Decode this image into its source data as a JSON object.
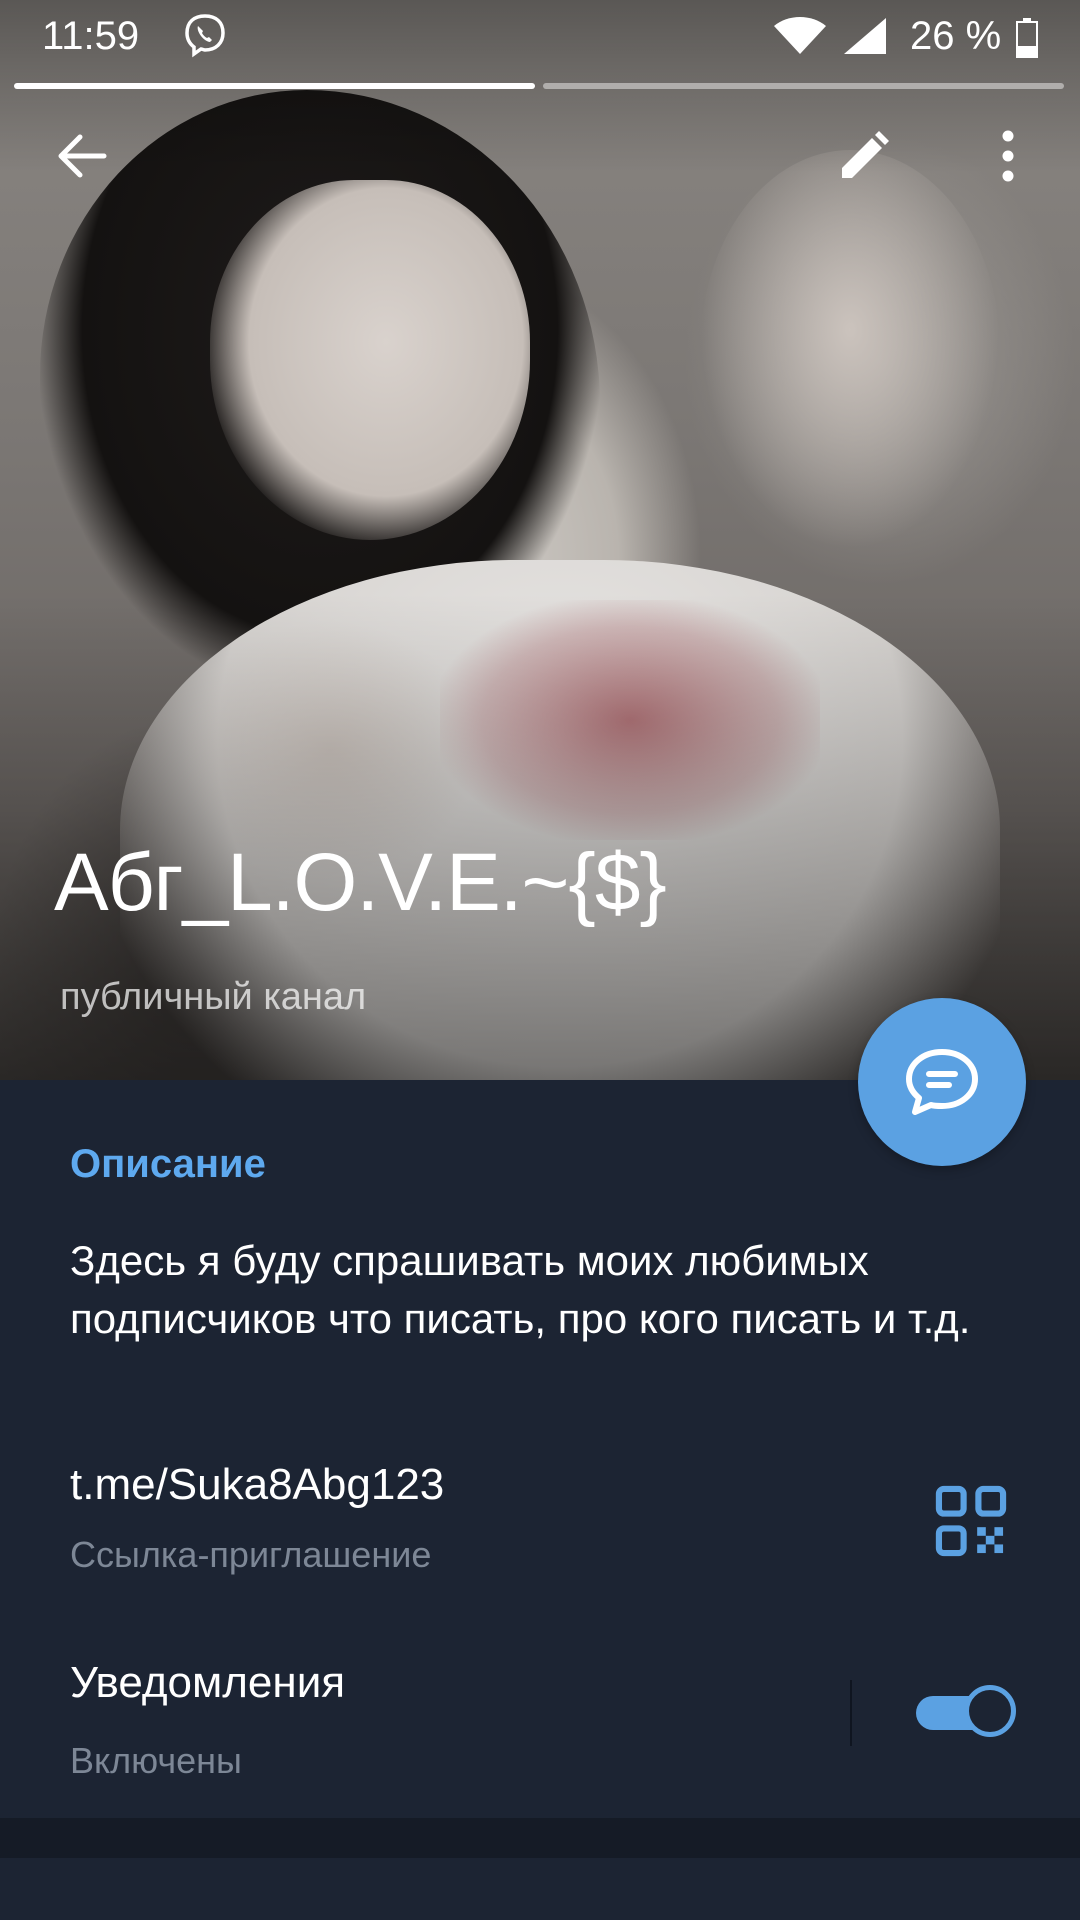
{
  "status_bar": {
    "time": "11:59",
    "battery_percent": "26 %",
    "icons": [
      "viber-icon",
      "wifi-icon",
      "signal-icon",
      "battery-icon"
    ]
  },
  "stories": {
    "count": 2,
    "active_index": 0
  },
  "header": {
    "title": "Абг_L.O.V.E.~{$}",
    "subtitle": "публичный канал",
    "icons": [
      "back-arrow-icon",
      "pencil-icon",
      "more-vertical-icon"
    ]
  },
  "fab": {
    "icon": "chat-bubble-icon",
    "color": "#5ba1e2"
  },
  "description": {
    "label": "Описание",
    "text": "Здесь я буду спрашивать моих любимых подписчиков что писать, про кого писать и т.д."
  },
  "invite": {
    "link": "t.me/Suka8Abg123",
    "hint": "Ссылка-приглашение",
    "icon": "qr-code-icon"
  },
  "notifications": {
    "title": "Уведомления",
    "state": "Включены",
    "enabled": true
  },
  "colors": {
    "accent": "#5ba1e2",
    "label_accent": "#5ea9ef",
    "panel_bg": "#1c2433",
    "secondary_text": "#7d8796"
  }
}
